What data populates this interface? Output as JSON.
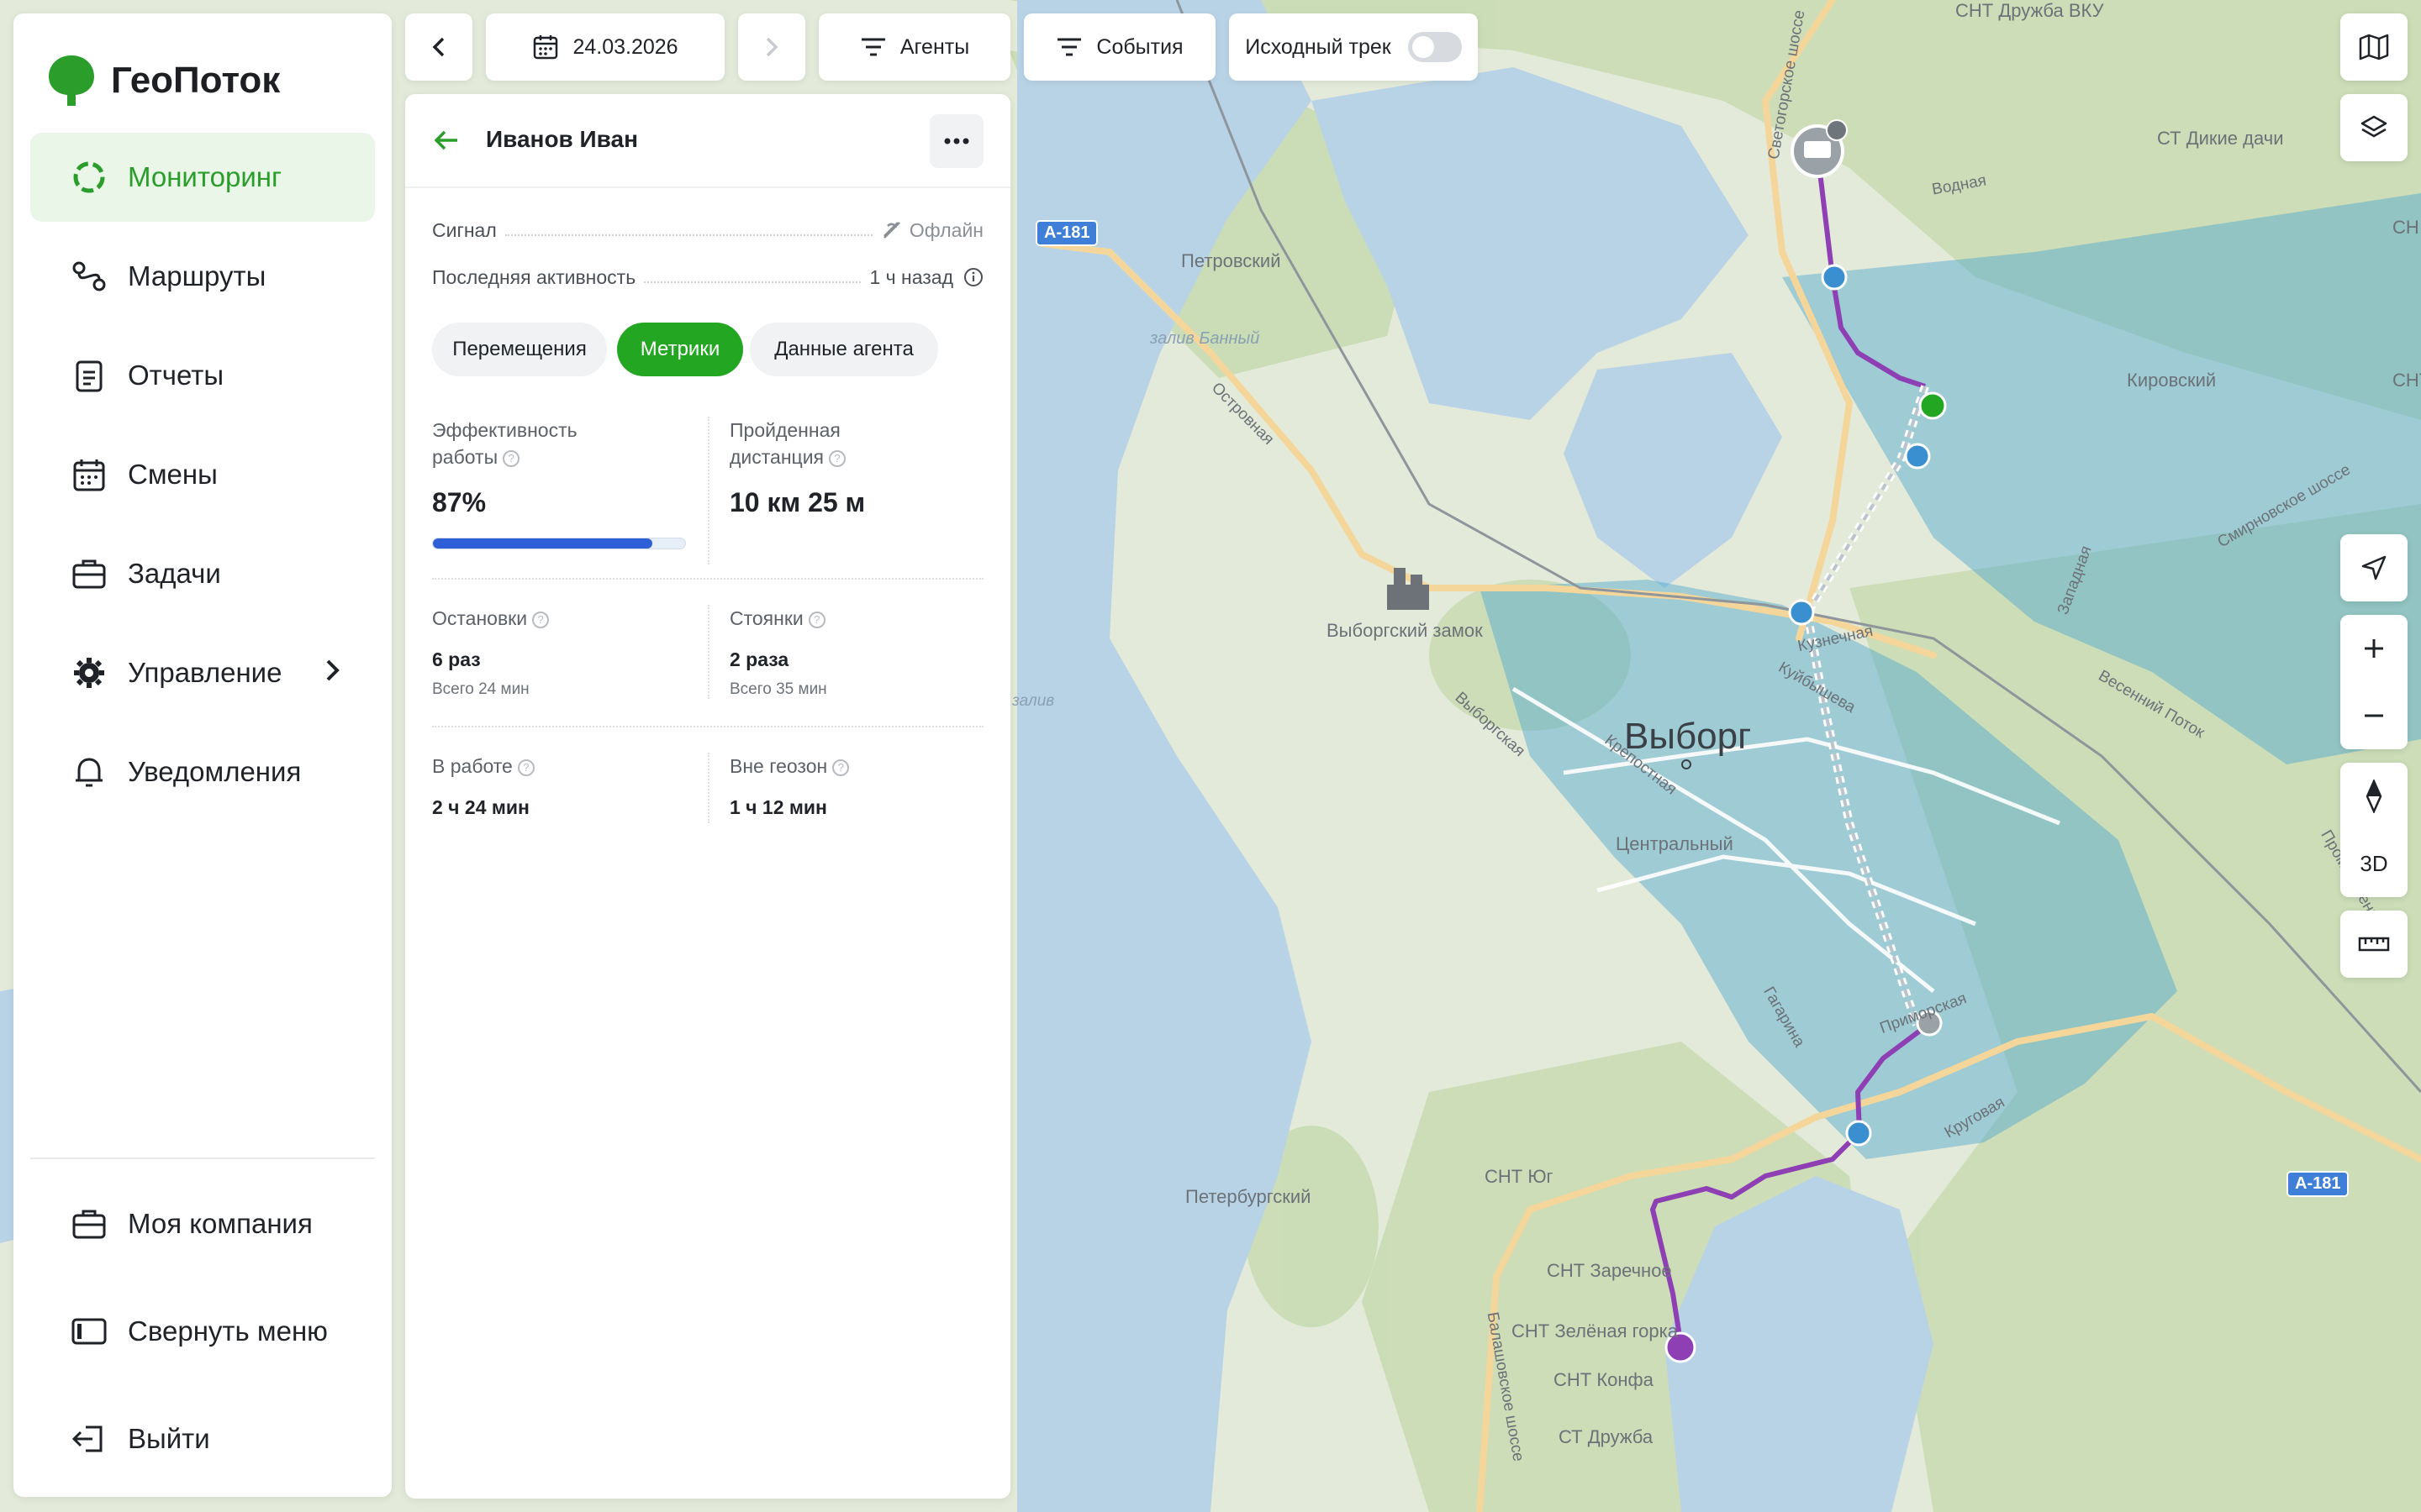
{
  "brand": {
    "name": "ГеоПоток",
    "color": "#2a9d2a"
  },
  "nav": {
    "items": [
      {
        "label": "Мониторинг",
        "icon": "monitoring-icon",
        "active": true
      },
      {
        "label": "Маршруты",
        "icon": "routes-icon"
      },
      {
        "label": "Отчеты",
        "icon": "reports-icon"
      },
      {
        "label": "Смены",
        "icon": "calendar-icon"
      },
      {
        "label": "Задачи",
        "icon": "briefcase-icon"
      },
      {
        "label": "Управление",
        "icon": "gear-icon"
      },
      {
        "label": "Уведомления",
        "icon": "bell-icon"
      }
    ],
    "bottom": [
      {
        "label": "Моя компания",
        "icon": "briefcase-icon"
      },
      {
        "label": "Свернуть меню",
        "icon": "collapse-icon"
      },
      {
        "label": "Выйти",
        "icon": "logout-icon"
      }
    ]
  },
  "toolbar": {
    "date": "24.03.2026",
    "agents_label": "Агенты",
    "events_label": "События",
    "source_track_label": "Исходный трек",
    "source_track_on": false
  },
  "agent": {
    "name": "Иванов Иван",
    "signal_label": "Сигнал",
    "signal_value": "Офлайн",
    "last_activity_label": "Последняя активность",
    "last_activity_value": "1 ч назад"
  },
  "tabs": [
    {
      "label": "Перемещения",
      "active": false
    },
    {
      "label": "Метрики",
      "active": true
    },
    {
      "label": "Данные агента",
      "active": false
    }
  ],
  "metrics": {
    "efficiency_label_1": "Эффективность",
    "efficiency_label_2": "работы",
    "efficiency_value": "87%",
    "efficiency_fraction": 0.87,
    "distance_label_1": "Пройденная",
    "distance_label_2": "дистанция",
    "distance_value": "10 км 25 м",
    "stops_label": "Остановки",
    "stops_value": "6 раз",
    "stops_total": "Всего 24 мин",
    "parkings_label": "Стоянки",
    "parkings_value": "2 раза",
    "parkings_total": "Всего 35 мин",
    "working_label": "В работе",
    "working_value": "2 ч 24 мин",
    "outside_geozones_label": "Вне геозон",
    "outside_geozones_value": "1 ч 12 мин"
  },
  "map": {
    "city": "Выборг",
    "labels": {
      "snt_druzhba_vku": "СНТ Дружба ВКУ",
      "st_dikie_dachi": "СТ Дикие дачи",
      "vodnaya": "Водная",
      "petrovsky": "Петровский",
      "zaliv_banny": "залив Банный",
      "ostrovnaya": "Островная",
      "kirovsky": "Кировский",
      "vyborg_castle": "Выборгский замок",
      "kuznechnaya": "Кузнечная",
      "vyborgskaya": "Выборгская",
      "krepostnaya": "Крепостная",
      "tsentralny": "Центральный",
      "vesenny_potok": "Весенний Поток",
      "smirnovskoe": "Смирновское шоссе",
      "zapadnaya": "Западная",
      "svetogorskoe": "Светогорское шоссе",
      "gagarina": "Гагарина",
      "krugovaya": "Круговая",
      "peterburgsky": "Петербургский",
      "snt_yug": "СНТ Юг",
      "snt_zarechnoe": "СНТ Заречное",
      "snt_zelenaya_gorka": "СНТ Зелёная горка",
      "snt_konfa": "СНТ Конфа",
      "st_druzhba": "СТ Дружба",
      "balashovskoe": "Балашовское шоссе",
      "primorskaya": "Приморская",
      "kuibysheva": "Куйбышева",
      "promyshlennaya": "Промышленная",
      "sn": "СН",
      "snt": "СНТ",
      "zaliv": "залив"
    },
    "road_badge": "А-181",
    "track_color": "#8e3fb4",
    "geozone_color": "#4aa6cf"
  },
  "map_controls": {
    "mode_3d": "3D"
  }
}
